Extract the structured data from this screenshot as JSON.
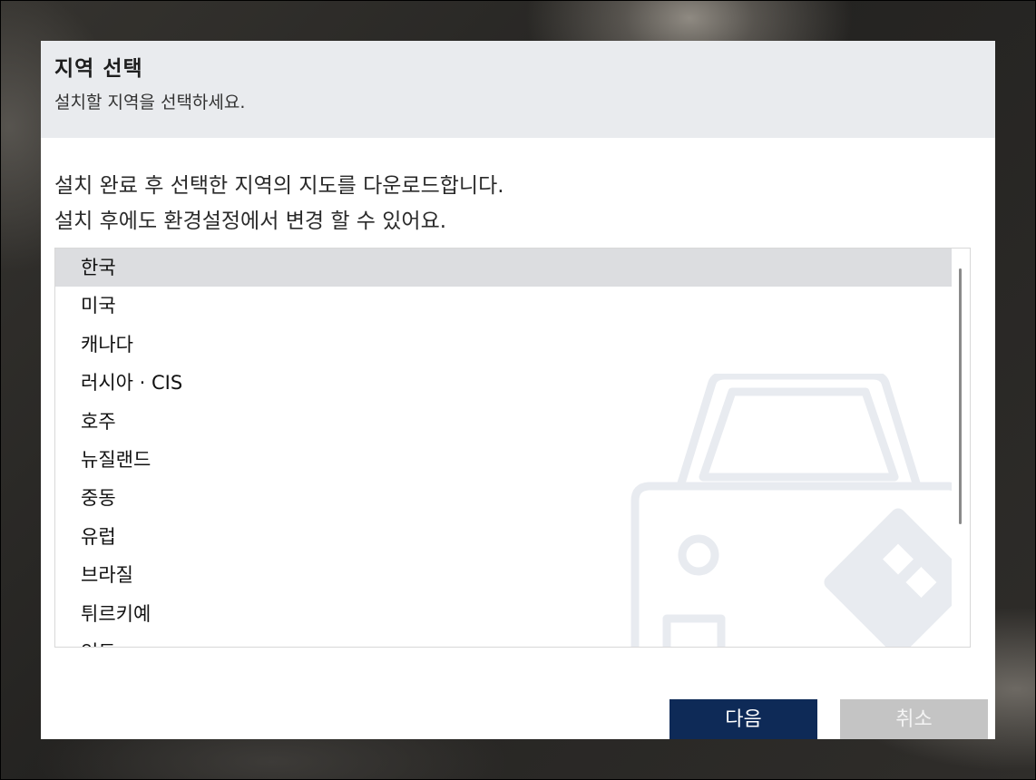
{
  "dialog": {
    "title": "지역 선택",
    "subtitle": "설치할 지역을 선택하세요.",
    "description": [
      "설치 완료 후 선택한 지역의 지도를 다운로드합니다.",
      "설치 후에도 환경설정에서 변경 할 수 있어요."
    ]
  },
  "regions": {
    "selected_index": 0,
    "items": [
      {
        "label": "한국"
      },
      {
        "label": "미국"
      },
      {
        "label": "캐나다"
      },
      {
        "label": "러시아 · CIS"
      },
      {
        "label": "호주"
      },
      {
        "label": "뉴질랜드"
      },
      {
        "label": "중동"
      },
      {
        "label": "유럽"
      },
      {
        "label": "브라질"
      },
      {
        "label": "튀르키예"
      },
      {
        "label": "인도"
      }
    ]
  },
  "buttons": {
    "next_label": "다음",
    "cancel_label": "취소"
  },
  "colors": {
    "header_bg": "#e9ebee",
    "selected_row": "#dcdde0",
    "primary_button": "#0e2a57",
    "disabled_button": "#c4c4c4"
  },
  "icons": {
    "watermark": "car-icon"
  }
}
